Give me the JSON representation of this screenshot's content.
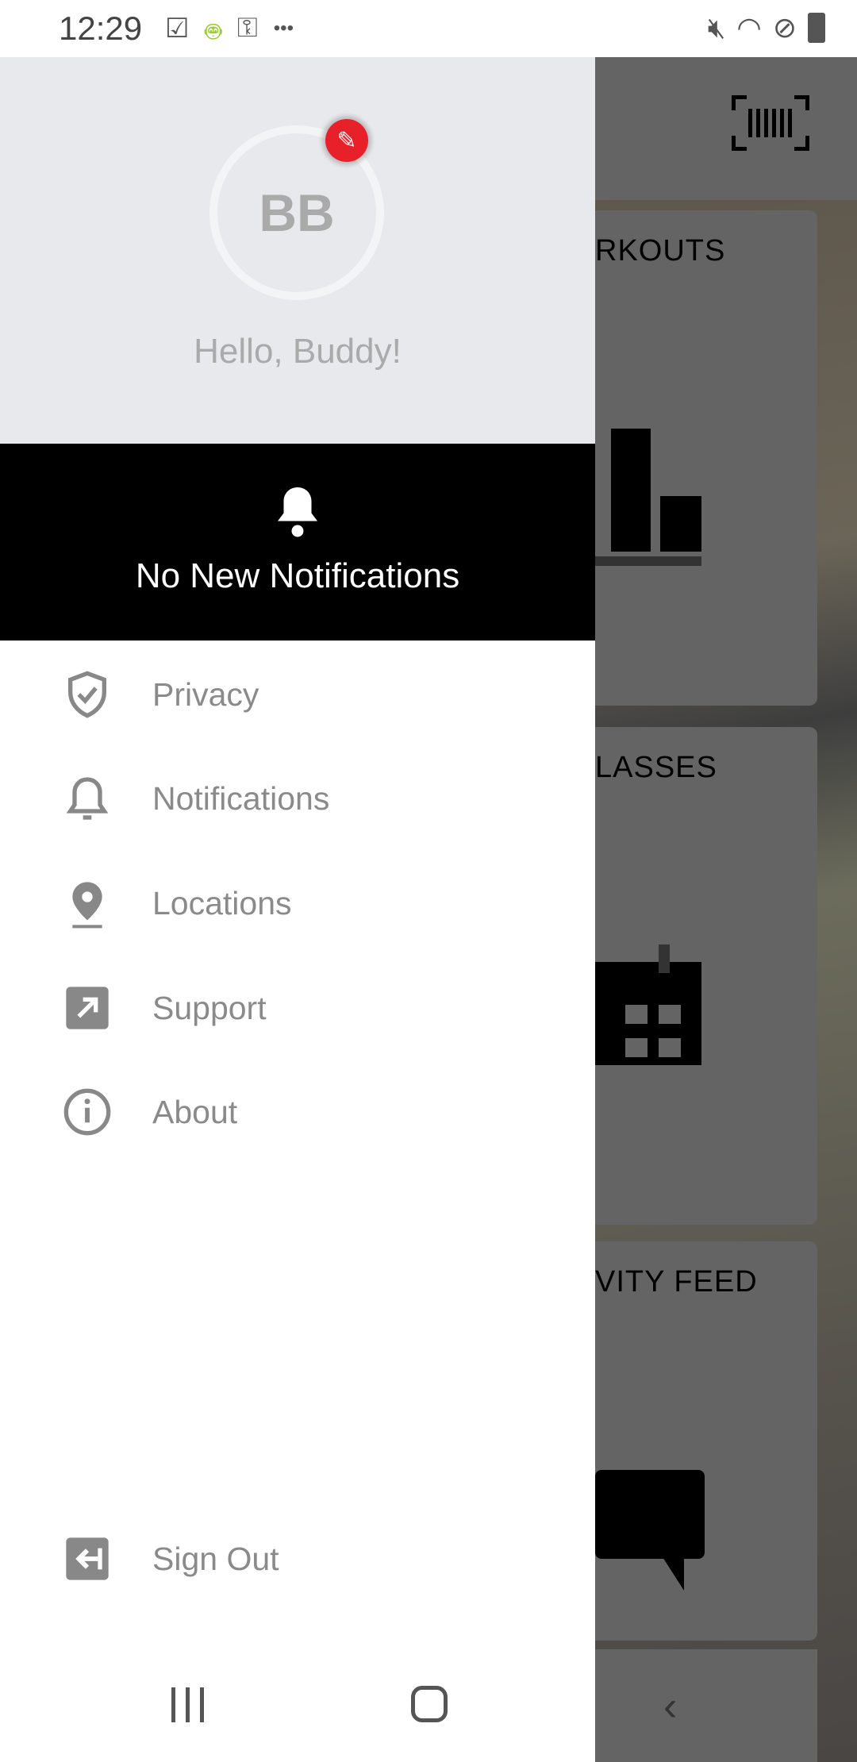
{
  "status_bar": {
    "time": "12:29",
    "left_icons": [
      "task-check-icon",
      "android-icon",
      "key-sim-icon",
      "more-dots-icon"
    ],
    "right_icons": [
      "mute-icon",
      "wifi-icon",
      "dnd-icon",
      "battery-icon"
    ],
    "more": "•••"
  },
  "background": {
    "cards": [
      {
        "title": "RKOUTS",
        "icon": "bar-chart-icon"
      },
      {
        "title": "LASSES",
        "icon": "calendar-icon"
      },
      {
        "title": "VITY FEED",
        "icon": "chat-bubble-icon"
      }
    ],
    "top_icon": "barcode-icon"
  },
  "drawer": {
    "avatar_initials": "BB",
    "greeting": "Hello, Buddy!",
    "edit_icon": "pencil-icon",
    "notifications_banner": "No New Notifications",
    "items": [
      {
        "label": "Privacy",
        "icon": "shield-check-icon"
      },
      {
        "label": "Notifications",
        "icon": "bell-icon"
      },
      {
        "label": "Locations",
        "icon": "map-pin-icon"
      },
      {
        "label": "Support",
        "icon": "external-link-icon"
      },
      {
        "label": "About",
        "icon": "info-icon"
      }
    ],
    "sign_out": {
      "label": "Sign Out",
      "icon": "sign-out-icon"
    }
  },
  "colors": {
    "accent": "#e8202a",
    "banner": "#000000",
    "header": "#e8e9ec",
    "text": "#8a8a8a"
  }
}
